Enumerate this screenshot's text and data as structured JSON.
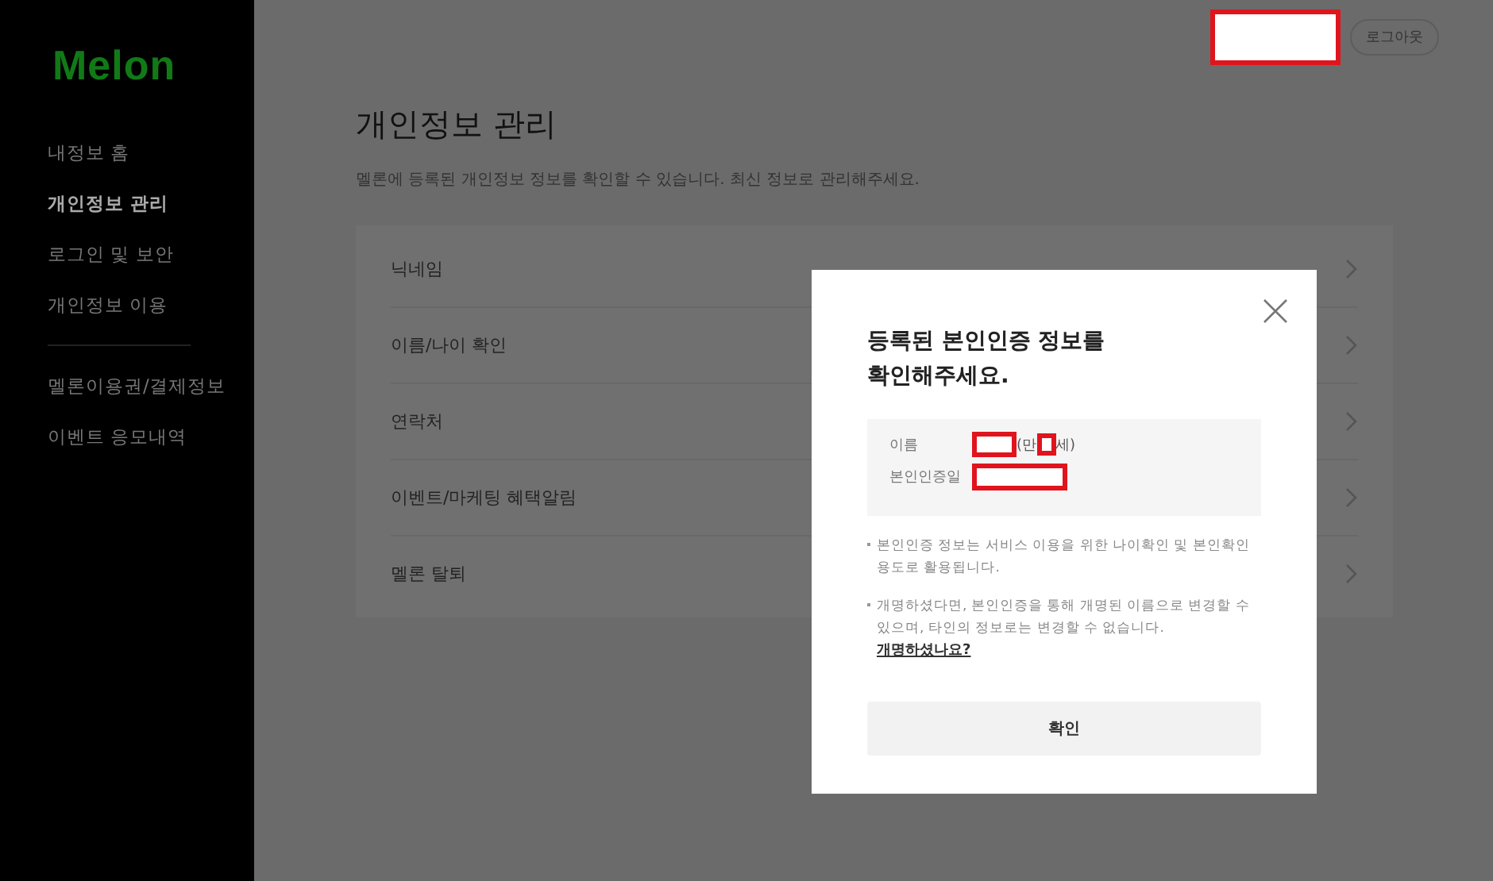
{
  "sidebar": {
    "logo": "Melon",
    "items": [
      {
        "label": "내정보 홈",
        "selected": false
      },
      {
        "label": "개인정보 관리",
        "selected": true
      },
      {
        "label": "로그인 및 보안",
        "selected": false
      },
      {
        "label": "개인정보 이용",
        "selected": false
      }
    ],
    "items_2": [
      {
        "label": "멜론이용권/결제정보",
        "selected": false
      },
      {
        "label": "이벤트 응모내역",
        "selected": false
      }
    ]
  },
  "header": {
    "logout": "로그아웃"
  },
  "page": {
    "title": "개인정보 관리",
    "subtitle": "멜론에 등록된 개인정보 정보를 확인할 수 있습니다. 최신 정보로 관리해주세요.",
    "rows": [
      {
        "label": "닉네임"
      },
      {
        "label": "이름/나이 확인"
      },
      {
        "label": "연락처"
      },
      {
        "label": "이벤트/마케팅 혜택알림"
      },
      {
        "label": "멜론 탈퇴"
      }
    ]
  },
  "modal": {
    "title": "등록된 본인인증 정보를\n확인해주세요.",
    "name_label": "이름",
    "age_prefix": "(만",
    "age_suffix": "세)",
    "date_label": "본인인증일",
    "notes": [
      "본인인증 정보는 서비스 이용을 위한 나이확인 및 본인확인 용도로 활용됩니다.",
      "개명하셨다면, 본인인증을 통해 개명된 이름으로 변경할 수 있으며, 타인의 정보로는 변경할 수 없습니다."
    ],
    "link": "개명하셨나요?",
    "confirm": "확인"
  }
}
